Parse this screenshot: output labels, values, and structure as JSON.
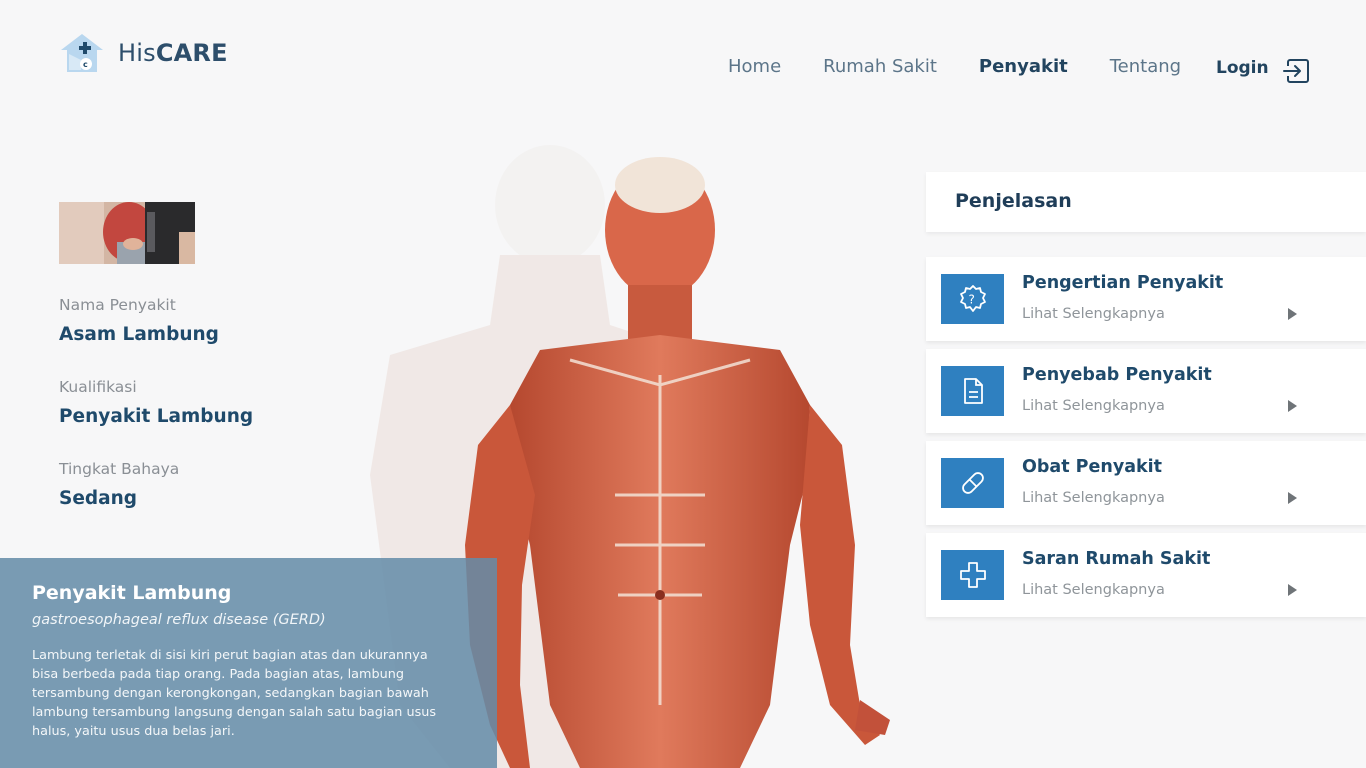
{
  "brand": {
    "name_light": "His",
    "name_bold": "CARE"
  },
  "nav": {
    "items": [
      {
        "label": "Home",
        "active": false
      },
      {
        "label": "Rumah Sakit",
        "active": false
      },
      {
        "label": "Penyakit",
        "active": true
      },
      {
        "label": "Tentang",
        "active": false
      }
    ],
    "login": "Login"
  },
  "disease": {
    "name_label": "Nama Penyakit",
    "name_value": "Asam Lambung",
    "qual_label": "Kualifikasi",
    "qual_value": "Penyakit Lambung",
    "danger_label": "Tingkat Bahaya",
    "danger_value": "Sedang"
  },
  "description": {
    "title": "Penyakit Lambung",
    "subtitle": "gastroesophageal reflux disease (GERD)",
    "text": "Lambung terletak di sisi kiri perut bagian atas dan ukurannya bisa berbeda pada tiap orang. Pada bagian atas, lambung tersambung dengan kerongkongan, sedangkan bagian bawah lambung tersambung langsung dengan salah satu bagian usus halus, yaitu usus dua belas jari."
  },
  "panel": {
    "title": "Penjelasan",
    "items": [
      {
        "title": "Pengertian Penyakit",
        "subtitle": "Lihat Selengkapnya",
        "icon": "question-badge-icon"
      },
      {
        "title": "Penyebab Penyakit",
        "subtitle": "Lihat Selengkapnya",
        "icon": "document-icon"
      },
      {
        "title": "Obat Penyakit",
        "subtitle": "Lihat Selengkapnya",
        "icon": "pill-icon"
      },
      {
        "title": "Saran Rumah Sakit",
        "subtitle": "Lihat Selengkapnya",
        "icon": "plus-icon"
      }
    ]
  },
  "colors": {
    "accent": "#2f80c0",
    "primary_text": "#1f4a6b",
    "overlay": "#648ca8"
  }
}
